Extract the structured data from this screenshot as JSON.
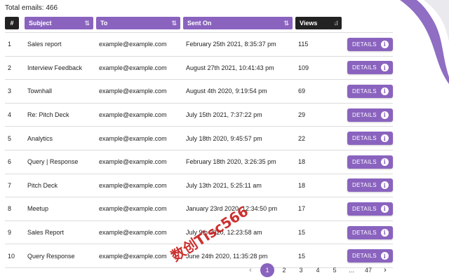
{
  "total_label": "Total emails: 466",
  "columns": {
    "num": "#",
    "subject": "Subject",
    "to": "To",
    "sent_on": "Sent On",
    "views": "Views"
  },
  "sort_icon": "sort-arrows-icon",
  "details_label": "DETAILS",
  "info_icon_glyph": "i",
  "rows": [
    {
      "n": "1",
      "subject": "Sales report",
      "to": "example@example.com",
      "sent": "February 25th 2021, 8:35:37 pm",
      "views": "115"
    },
    {
      "n": "2",
      "subject": "Interview Feedback",
      "to": "example@example.com",
      "sent": "August 27th 2021, 10:41:43 pm",
      "views": "109"
    },
    {
      "n": "3",
      "subject": "Townhall",
      "to": "example@example.com",
      "sent": "August 4th 2020, 9:19:54 pm",
      "views": "69"
    },
    {
      "n": "4",
      "subject": "Re: Pitch Deck",
      "to": "example@example.com",
      "sent": "July 15th 2021, 7:37:22 pm",
      "views": "29"
    },
    {
      "n": "5",
      "subject": "Analytics",
      "to": "example@example.com",
      "sent": "July 18th 2020, 9:45:57 pm",
      "views": "22"
    },
    {
      "n": "6",
      "subject": "Query | Response",
      "to": "example@example.com",
      "sent": "February 18th 2020, 3:26:35 pm",
      "views": "18"
    },
    {
      "n": "7",
      "subject": "Pitch Deck",
      "to": "example@example.com",
      "sent": "July 13th 2021, 5:25:11 am",
      "views": "18"
    },
    {
      "n": "8",
      "subject": "Meetup",
      "to": "example@example.com",
      "sent": "January 23rd 2020, 12:34:50 pm",
      "views": "17"
    },
    {
      "n": "9",
      "subject": "Sales Report",
      "to": "example@example.com",
      "sent": "July 9th 2020, 12:23:58 am",
      "views": "15"
    },
    {
      "n": "10",
      "subject": "Query Response",
      "to": "example@example.com",
      "sent": "June 24th 2020, 11:35:28 pm",
      "views": "15"
    }
  ],
  "pagination": {
    "prev": "‹",
    "pages": [
      "1",
      "2",
      "3",
      "4",
      "5",
      "...",
      "47"
    ],
    "active": "1",
    "next": "›"
  },
  "watermark": "数创Tisc566",
  "colors": {
    "accent": "#8a63bf",
    "header_dark": "#222222",
    "decoration": "#7b55b8"
  }
}
